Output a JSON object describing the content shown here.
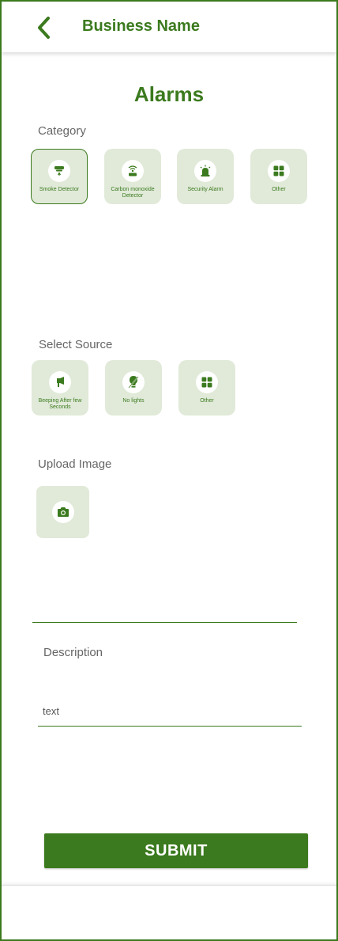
{
  "header": {
    "business_name": "Business Name"
  },
  "page_title": "Alarms",
  "category": {
    "label": "Category",
    "items": [
      {
        "label": "Smoke Detector",
        "icon": "smoke-detector-icon",
        "selected": true
      },
      {
        "label": "Carbon monoxide Detector",
        "icon": "co-detector-icon",
        "selected": false
      },
      {
        "label": "Security Alarm",
        "icon": "security-alarm-icon",
        "selected": false
      },
      {
        "label": "Other",
        "icon": "grid-icon",
        "selected": false
      }
    ]
  },
  "source": {
    "label": "Select Source",
    "items": [
      {
        "label": "Beeping After few Seconds",
        "icon": "megaphone-icon"
      },
      {
        "label": "No lights",
        "icon": "lightbulb-off-icon"
      },
      {
        "label": "Other",
        "icon": "grid-icon"
      }
    ]
  },
  "upload": {
    "label": "Upload Image",
    "icon": "camera-icon"
  },
  "description": {
    "label": "Description",
    "placeholder": "text"
  },
  "submit_label": "SUBMIT",
  "colors": {
    "accent": "#3b7a1e",
    "tile_bg": "#e1ead9",
    "label_gray": "#666666"
  }
}
